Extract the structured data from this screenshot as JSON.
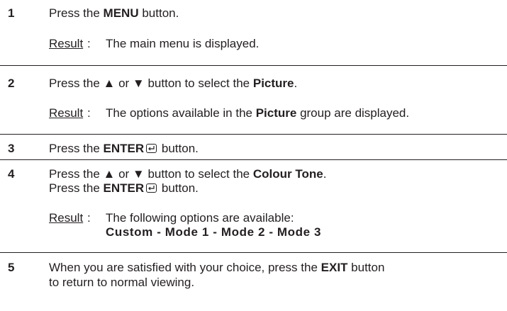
{
  "steps": [
    {
      "number": "1",
      "text": {
        "pre": "Press the ",
        "bold": "MENU",
        "post": " button."
      },
      "result_label": "Result",
      "result_colon": ":",
      "result_text": "The main menu is displayed."
    },
    {
      "number": "2",
      "text": {
        "pre": "Press the ▲ or ▼ button to select the ",
        "bold": "Picture",
        "post": "."
      },
      "result_label": "Result",
      "result_colon": ":",
      "result_text": {
        "pre": "The options available in the ",
        "bold": "Picture",
        "post": " group are displayed."
      }
    },
    {
      "number": "3",
      "text": {
        "pre": "Press the ",
        "bold": "ENTER",
        "post": " button."
      }
    },
    {
      "number": "4",
      "text": {
        "pre": "Press the ▲ or ▼ button to select the ",
        "bold": "Colour Tone",
        "post": "."
      },
      "text2": {
        "pre": "Press the ",
        "bold": "ENTER",
        "post": " button."
      },
      "result_label": "Result",
      "result_colon": ":",
      "result_text": "The following options are available:",
      "result_options": "Custom - Mode 1 - Mode 2 - Mode 3"
    },
    {
      "number": "5",
      "text": {
        "pre": "When you are satisfied with your choice, press the ",
        "bold": "EXIT",
        "post": " button"
      },
      "text2": "to return to normal viewing."
    }
  ],
  "icons": {
    "enter": "enter-icon"
  }
}
